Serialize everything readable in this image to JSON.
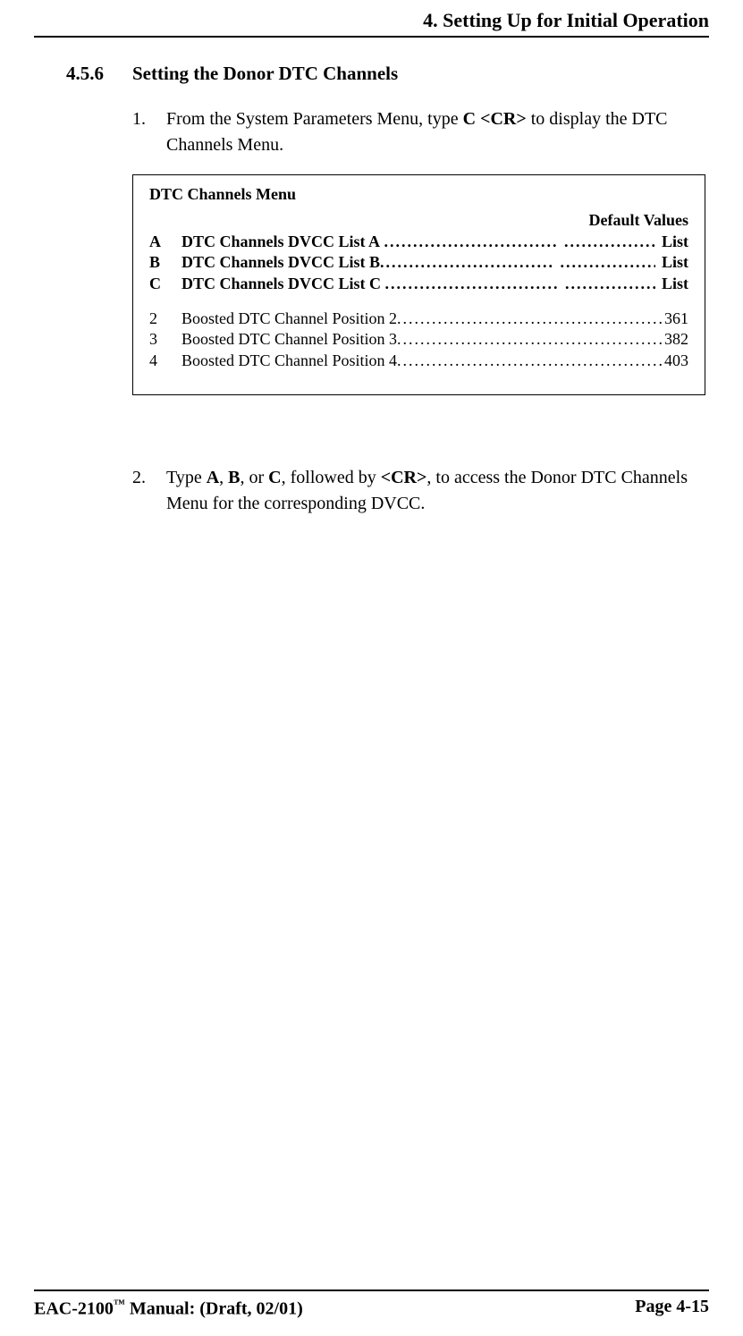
{
  "header": {
    "chapter_title": "4. Setting Up for Initial Operation"
  },
  "section": {
    "number": "4.5.6",
    "title": "Setting the Donor DTC Channels"
  },
  "steps": {
    "s1": {
      "num": "1.",
      "pre": "From the System Parameters Menu, type ",
      "bold1": "C <CR>",
      "post": " to display the DTC Channels Menu."
    },
    "s2": {
      "num": "2.",
      "t1": "Type ",
      "b1": "A",
      "t2": ", ",
      "b2": "B",
      "t3": ", or ",
      "b3": "C",
      "t4": ", followed by ",
      "b4": "<CR>",
      "t5": ", to access the Donor DTC Channels Menu for the corresponding DVCC."
    }
  },
  "menu": {
    "title": "DTC Channels Menu",
    "default_label": "Default Values",
    "rows_bold": [
      {
        "key": "A",
        "label": "DTC Channels DVCC List A",
        "value": "List"
      },
      {
        "key": "B",
        "label": "DTC Channels DVCC List B",
        "value": "List"
      },
      {
        "key": "C",
        "label": "DTC Channels DVCC List C",
        "value": "List"
      }
    ],
    "rows_plain": [
      {
        "key": "2",
        "label": "Boosted DTC Channel Position 2",
        "value": "361"
      },
      {
        "key": "3",
        "label": "Boosted DTC Channel Position 3",
        "value": "382"
      },
      {
        "key": "4",
        "label": "Boosted DTC Channel Position 4",
        "value": "403"
      }
    ]
  },
  "footer": {
    "left_pre": "EAC-2100",
    "left_tm": "™",
    "left_post": " Manual: (Draft, 02/01)",
    "right": "Page 4-15"
  }
}
